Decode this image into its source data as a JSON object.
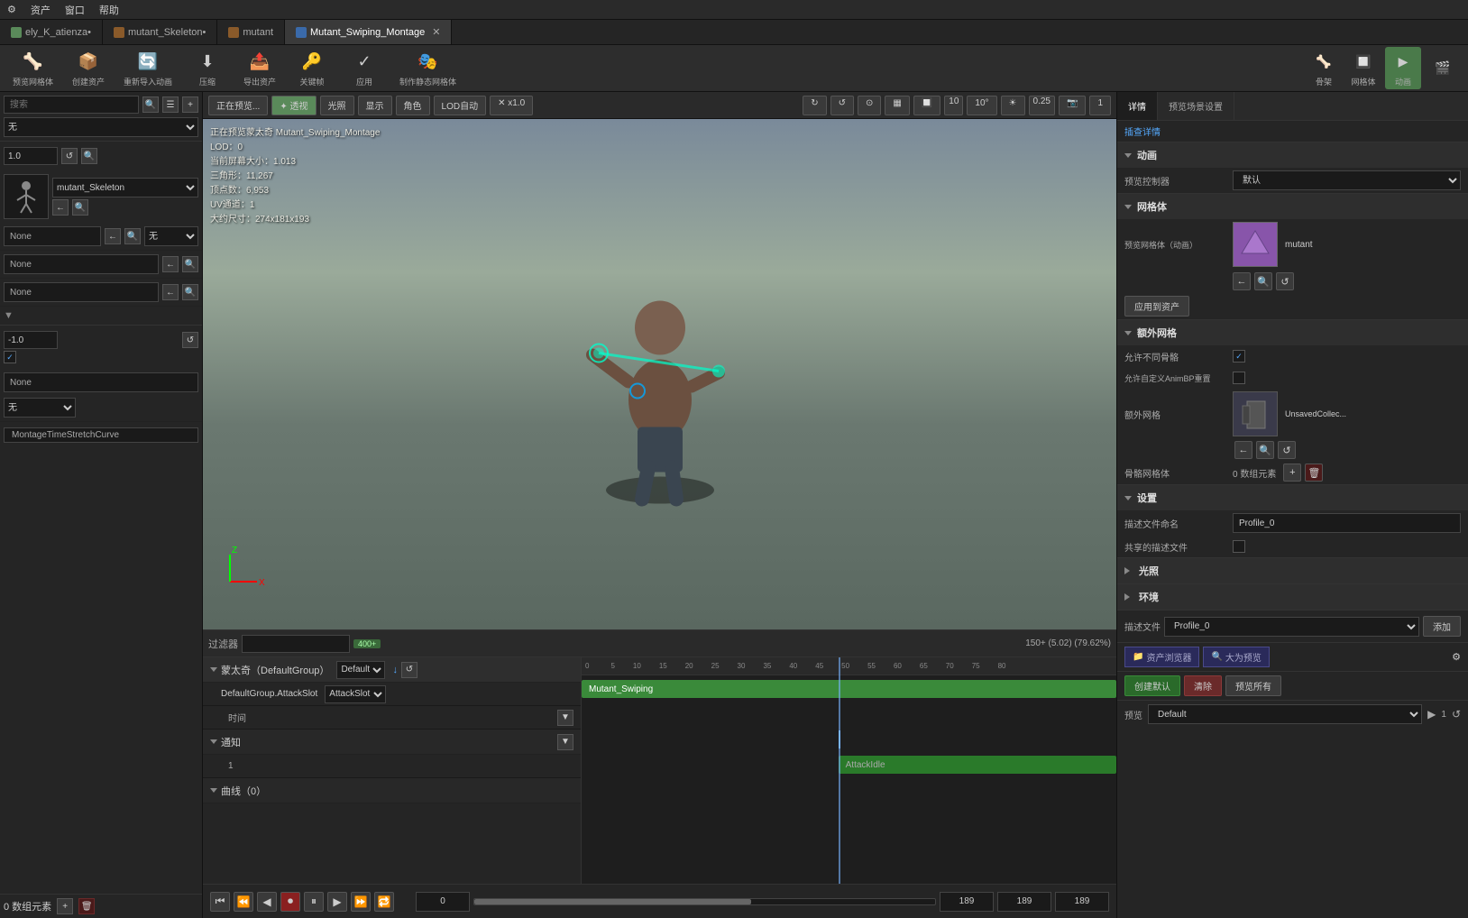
{
  "topmenu": {
    "items": [
      "资产",
      "窗口",
      "帮助"
    ]
  },
  "tabs": [
    {
      "label": "ely_K_atienza•",
      "active": false
    },
    {
      "label": "mutant_Skeleton•",
      "active": false
    },
    {
      "label": "mutant",
      "active": false
    },
    {
      "label": "Mutant_Swiping_Montage",
      "active": true
    }
  ],
  "toolbar": {
    "buttons": [
      {
        "icon": "🦴",
        "label": "预览网格体"
      },
      {
        "icon": "📦",
        "label": "创建资产"
      },
      {
        "icon": "🔄",
        "label": "重新导入动画"
      },
      {
        "icon": "⬇",
        "label": "压缩"
      },
      {
        "icon": "📤",
        "label": "导出资产"
      },
      {
        "icon": "🔑",
        "label": "关键帧"
      },
      {
        "icon": "✓",
        "label": "应用"
      },
      {
        "icon": "🎭",
        "label": "制作静态网格体"
      }
    ],
    "right_buttons": [
      {
        "icon": "🦴",
        "label": "骨架"
      },
      {
        "icon": "🔲",
        "label": "网格体"
      },
      {
        "icon": "▶",
        "label": "动画"
      },
      {
        "icon": "🎬",
        "label": ""
      }
    ]
  },
  "viewport_toolbar": {
    "buttons": [
      "透视",
      "光照",
      "显示",
      "角色",
      "LOD自动",
      "x1.0"
    ]
  },
  "left_panel": {
    "search_placeholder": "搜索",
    "dropdown_value": "无",
    "num_value1": "1.0",
    "skeleton_name": "mutant_Skeleton",
    "slots": [
      {
        "label": "None"
      },
      {
        "label": "None"
      },
      {
        "label": "None"
      }
    ],
    "num_value2": "-1.0",
    "checked": true,
    "slots2": [
      {
        "label": "None",
        "sub": "无"
      }
    ],
    "curve_btn": "MontageTimeStretchCurve",
    "elements_label": "0 数组元素"
  },
  "viewport": {
    "info_lines": [
      "正在预览蒙太奇 Mutant_Swiping_Montage",
      "LOD：0",
      "当前屏幕大小：1.013",
      "三角形：11,267",
      "顶点数：6,953",
      "UV通道：1",
      "大约尺寸：274x181x193"
    ]
  },
  "timeline": {
    "filter_label": "过滤器",
    "filter_count": "400+",
    "group_name": "蒙太奇（DefaultGroup）",
    "slot_name": "DefaultGroup.AttackSlot",
    "time_label": "时间",
    "notify_label": "通知",
    "notify_count": "1",
    "curves_label": "曲线（0）",
    "green_bar1": "Mutant_Swiping",
    "green_bar2": "AttackIdle",
    "right_label": "150+ (5.02) (79.62%)",
    "marker1": "1",
    "marker2": "1",
    "controls": {
      "time_start": "0",
      "time_mid": "0",
      "time_end": "189",
      "time_end2": "189",
      "time_end3": "189"
    }
  },
  "right_panel": {
    "tabs": [
      "详情",
      "预览场景设置"
    ],
    "active_tab": "详情",
    "extra_link": "插查详情",
    "sections": {
      "animation": {
        "title": "动画",
        "fields": [
          {
            "label": "预览控制器",
            "value": "默认"
          }
        ]
      },
      "mesh": {
        "title": "网格体",
        "thumb_color": "#8855aa",
        "mesh_name": "mutant",
        "fields": [
          {
            "label": "预览网格体（动画）",
            "value": ""
          },
          {
            "label": "应用到资产",
            "value": ""
          }
        ]
      },
      "extra_mesh": {
        "title": "额外网格",
        "fields": [
          {
            "label": "允许不同骨骼",
            "checked": true
          },
          {
            "label": "允许自定义AnimBP重置",
            "checked": false
          }
        ],
        "extra_mesh_name": "UnsavedCollec...",
        "bone_mesh_label": "骨骼网格体",
        "bone_mesh_count": "0 数组元素"
      },
      "settings": {
        "title": "设置",
        "desc_file_label": "描述文件命名",
        "desc_file_value": "Profile_0",
        "shared_desc_label": "共享的描述文件",
        "shared_checked": false
      },
      "light": {
        "title": "光照"
      },
      "env": {
        "title": "环境"
      }
    },
    "desc_file_dropdown": "Profile_0",
    "add_btn": "添加",
    "asset_browser_label": "资产浏览器",
    "large_preview_label": "大为预览",
    "create_default_btn": "创建默认",
    "clear_btn": "清除",
    "preview_all_btn": "预览所有",
    "preview_label": "预览",
    "default_value": "Default",
    "preview_controls": {
      "play": "▶",
      "num": "1",
      "reset": "↺"
    }
  }
}
